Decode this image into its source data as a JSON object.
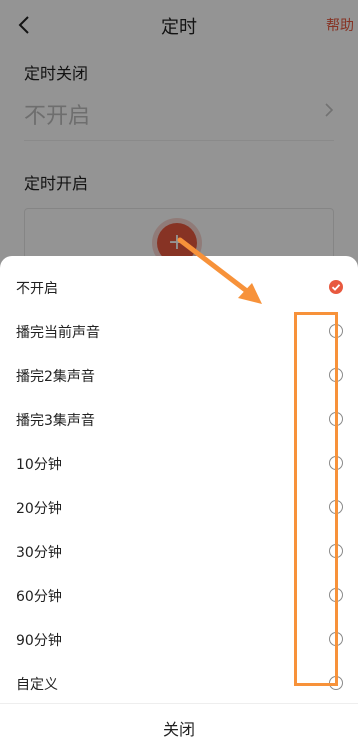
{
  "header": {
    "title": "定时",
    "help_label": "帮助"
  },
  "timer_close": {
    "label": "定时关闭",
    "value": "不开启"
  },
  "timer_start": {
    "label": "定时开启"
  },
  "sheet": {
    "options": [
      {
        "label": "不开启",
        "checked": true
      },
      {
        "label": "播完当前声音",
        "checked": false
      },
      {
        "label": "播完2集声音",
        "checked": false
      },
      {
        "label": "播完3集声音",
        "checked": false
      },
      {
        "label": "10分钟",
        "checked": false
      },
      {
        "label": "20分钟",
        "checked": false
      },
      {
        "label": "30分钟",
        "checked": false
      },
      {
        "label": "60分钟",
        "checked": false
      },
      {
        "label": "90分钟",
        "checked": false
      },
      {
        "label": "自定义",
        "checked": false
      }
    ],
    "close_label": "关闭"
  },
  "colors": {
    "accent": "#e8593f",
    "annotation": "#f7923a"
  },
  "icons": {
    "back": "chevron-left-icon",
    "chevron": "chevron-right-icon",
    "add": "plus-icon",
    "check": "check-icon"
  }
}
